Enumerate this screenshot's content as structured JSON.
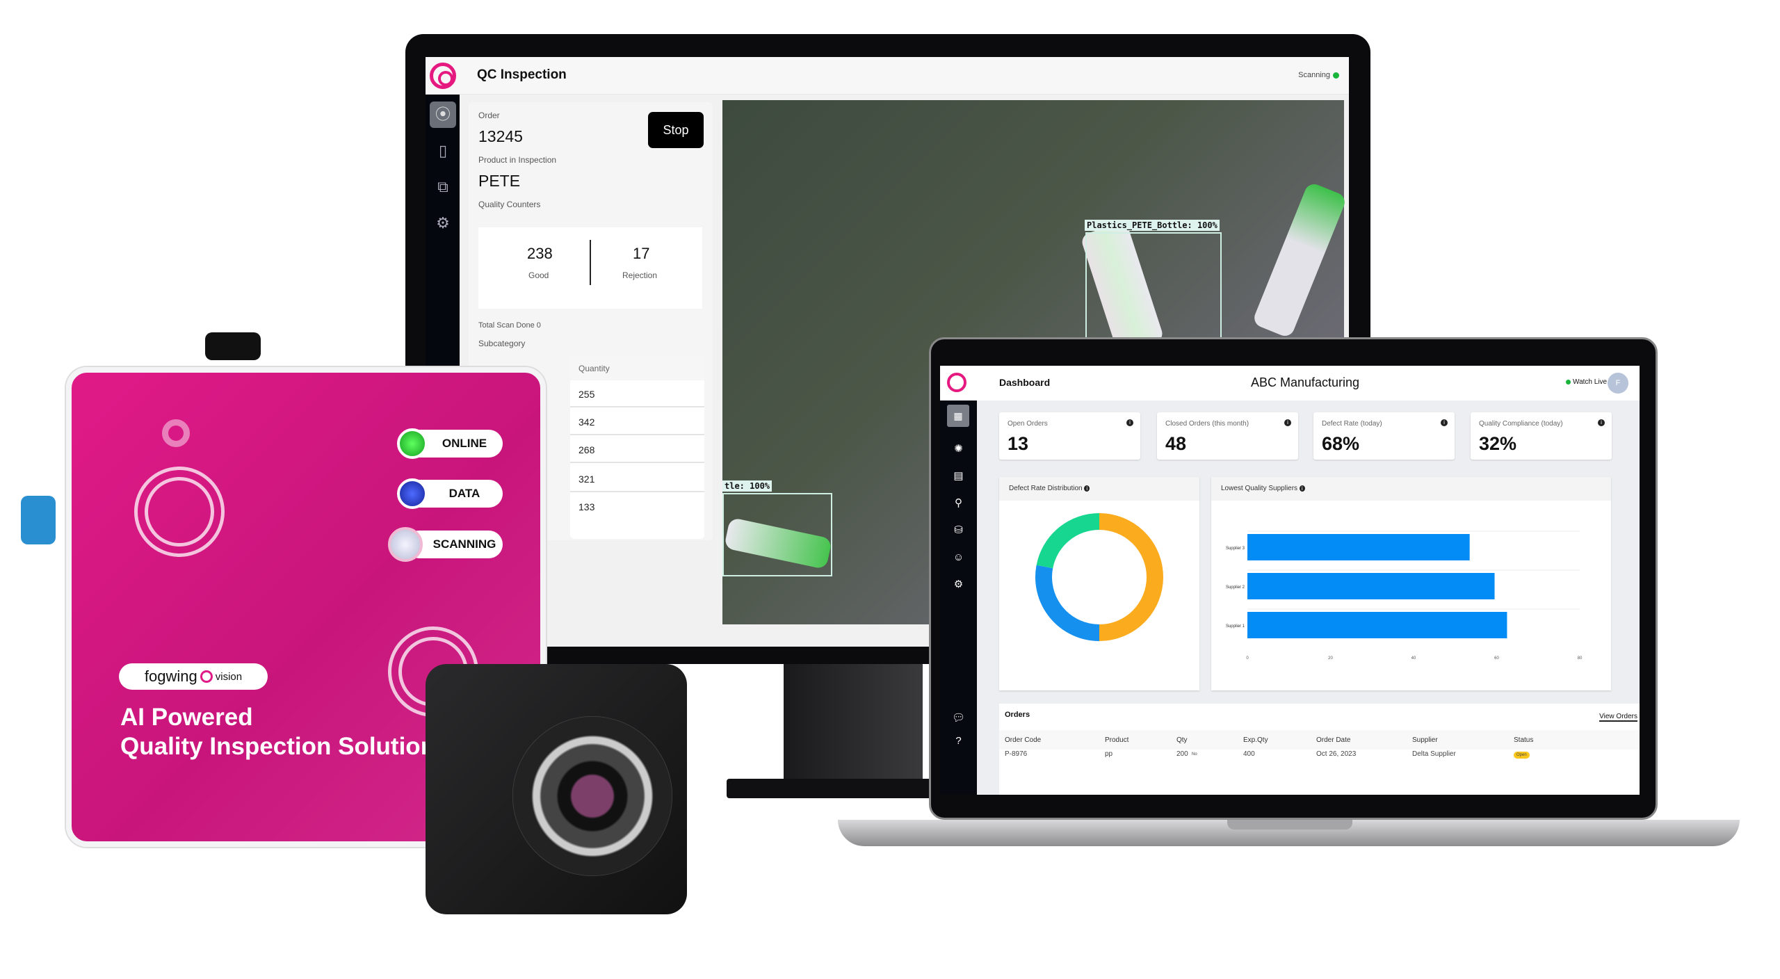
{
  "monitor_app": {
    "title": "QC Inspection",
    "status": "Scanning",
    "status_color": "#19b53a",
    "sidebar_icons": [
      "aperture-icon",
      "panel-icon",
      "copy-icon",
      "gear-icon"
    ],
    "order_label": "Order",
    "order_value": "13245",
    "stop_label": "Stop",
    "product_label": "Product in Inspection",
    "product_value": "PETE",
    "quality_counters_label": "Quality Counters",
    "good_count": "238",
    "good_label": "Good",
    "rejection_count": "17",
    "rejection_label": "Rejection",
    "total_scan": "Total Scan Done 0",
    "subcategory_label": "Subcategory",
    "quantity_header": "Quantity",
    "quantities": [
      "255",
      "342",
      "268",
      "321",
      "133"
    ],
    "detections": [
      "Plastics_PETE_Bottle: 100%",
      "tle: 100%"
    ]
  },
  "device": {
    "leds": [
      {
        "label": "ONLINE",
        "color": "#22c22a"
      },
      {
        "label": "DATA",
        "color": "#1d3fd0"
      },
      {
        "label": "SCANNING",
        "color": "#d8dbe8"
      }
    ],
    "brand_name": "fogwing",
    "brand_suffix": "vision",
    "tagline_1": "AI Powered",
    "tagline_2": "Quality Inspection Solution",
    "brand_color": "#e01a87"
  },
  "dashboard": {
    "section": "Dashboard",
    "company": "ABC Manufacturing",
    "watch_live": "Watch Live",
    "avatar_initial": "F",
    "kpis": [
      {
        "label": "Open Orders",
        "value": "13"
      },
      {
        "label": "Closed Orders (this month)",
        "value": "48"
      },
      {
        "label": "Defect Rate (today)",
        "value": "68%"
      },
      {
        "label": "Quality Compliance (today)",
        "value": "32%"
      }
    ],
    "orders": {
      "title": "Orders",
      "view_link": "View Orders",
      "columns": [
        "Order Code",
        "Product",
        "Qty",
        "Exp.Qty",
        "Order Date",
        "Supplier",
        "Status"
      ],
      "rows": [
        {
          "code": "P-8976",
          "product": "pp",
          "qty": "200",
          "qty_unit": "No",
          "exp_qty": "400",
          "date": "Oct 26, 2023",
          "supplier": "Delta Supplier",
          "status": "Open"
        }
      ]
    }
  },
  "chart_data": [
    {
      "type": "pie",
      "title": "Defect Rate Distribution",
      "donut": true,
      "values": [
        50,
        28,
        22
      ],
      "colors": [
        "#fbab1e",
        "#1590ef",
        "#17d68f"
      ]
    },
    {
      "type": "bar",
      "orientation": "horizontal",
      "title": "Lowest Quality Suppliers",
      "categories": [
        "Supplier 3",
        "Supplier 2",
        "Supplier 1"
      ],
      "values": [
        53.5,
        59.5,
        62.5
      ],
      "xlim": [
        0,
        80
      ],
      "xticks": [
        "0",
        "20",
        "40",
        "60",
        "80"
      ],
      "color": "#038cf6",
      "grid": true
    }
  ]
}
